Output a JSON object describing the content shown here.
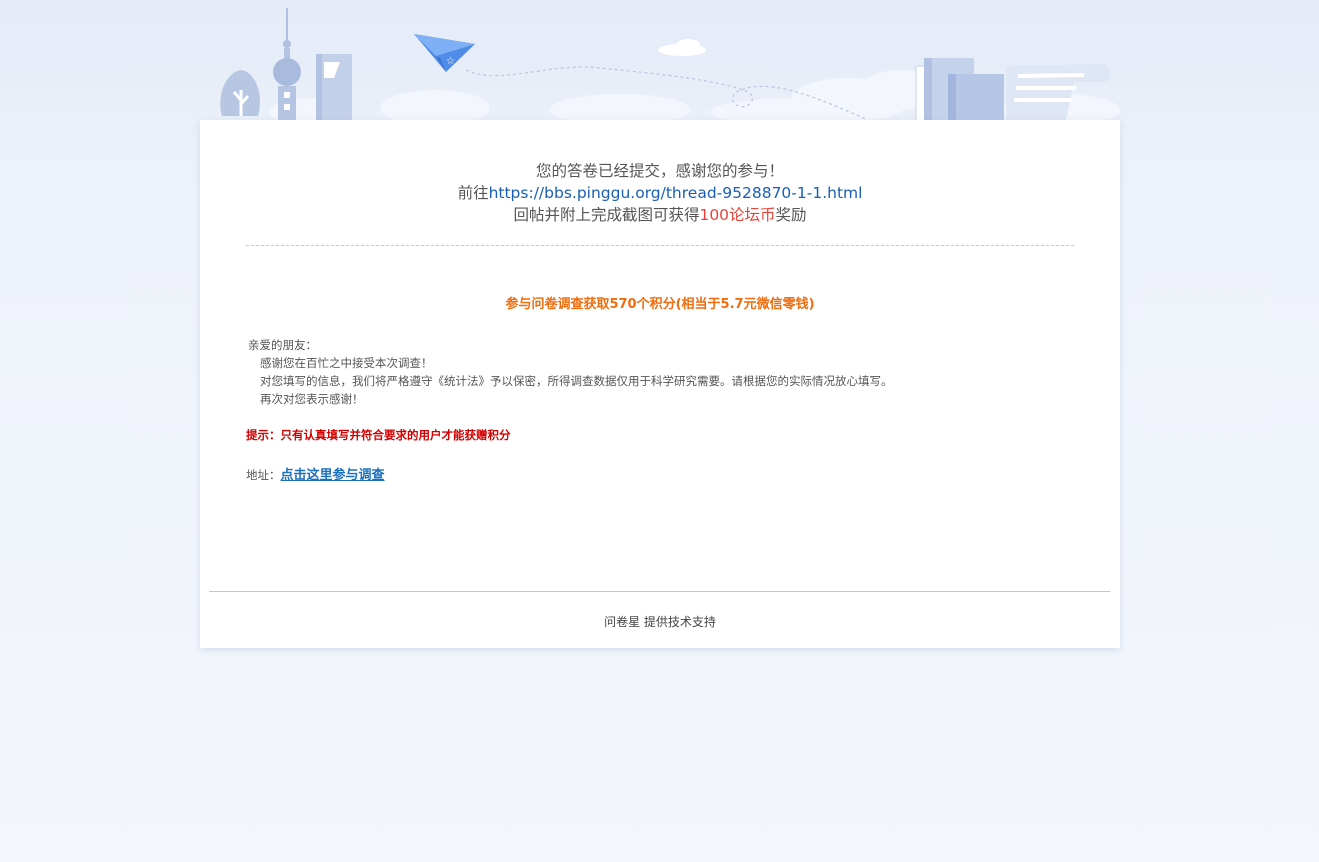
{
  "completion": {
    "line1": "您的答卷已经提交，感谢您的参与！",
    "line2_prefix": "前往",
    "line2_link": "https://bbs.pinggu.org/thread-9528870-1-1.html",
    "line3_prefix": "回帖并附上完成截图可获得",
    "line3_highlight": "100论坛币",
    "line3_suffix": "奖励"
  },
  "survey": {
    "reward_title": "参与问卷调查获取570个积分(相当于5.7元微信零钱)",
    "greeting": "亲爱的朋友：",
    "body_lines": [
      "感谢您在百忙之中接受本次调查！",
      "对您填写的信息，我们将严格遵守《统计法》予以保密，所得调查数据仅用于科学研究需要。请根据您的实际情况放心填写。",
      "再次对您表示感谢！"
    ],
    "tip": "提示：只有认真填写并符合要求的用户才能获赠积分",
    "address_label": "地址：",
    "address_link": "点击这里参与调查"
  },
  "footer": {
    "brand": "问卷星",
    "text": " 提供技术支持"
  },
  "colors": {
    "link": "#1a5fb4",
    "highlight_red": "#e8433a",
    "reward_orange": "#f06c0c",
    "tip_red": "#d40000"
  },
  "icons": [
    "tree-icon",
    "tv-tower-icon",
    "building-icon",
    "paper-plane-icon",
    "cloud-icon",
    "books-icon",
    "scroll-icon"
  ]
}
